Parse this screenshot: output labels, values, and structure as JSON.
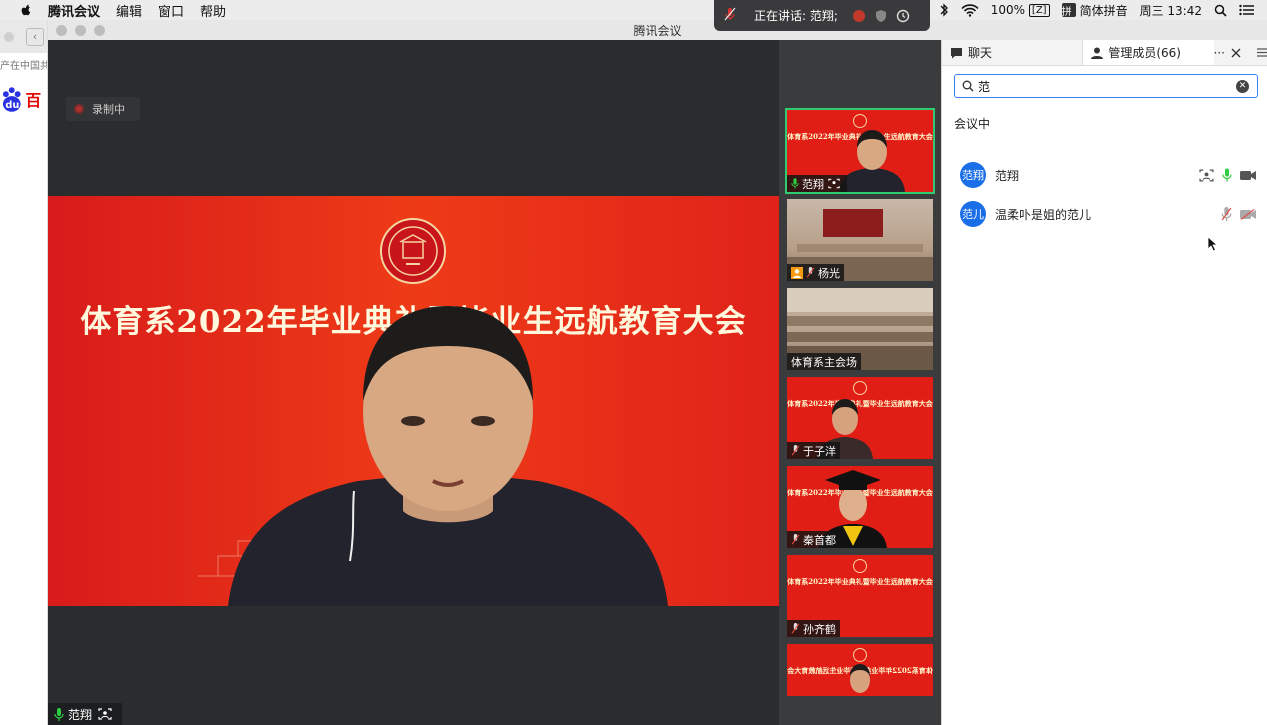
{
  "menubar": {
    "app": "腾讯会议",
    "items": [
      "编辑",
      "窗口",
      "帮助"
    ],
    "battery": "100%",
    "battery_badge": "[Z]",
    "ime_badge": "拼",
    "ime": "简体拼音",
    "clock": "周三 13:42"
  },
  "speaking": {
    "text": "正在讲话: 范翔;"
  },
  "browser": {
    "partial_text": "产在中国共产",
    "logo": "du百"
  },
  "window": {
    "title": "腾讯会议"
  },
  "stage": {
    "recording": "录制中",
    "banner_title": "体育系2022年毕业典礼暨毕业生远航教育大会",
    "speaker_name": "范翔"
  },
  "thumbnails": [
    {
      "name": "范翔",
      "type": "banner",
      "active": true
    },
    {
      "name": "杨光",
      "type": "room",
      "active": false
    },
    {
      "name": "体育系主会场",
      "type": "room",
      "active": false
    },
    {
      "name": "于子洋",
      "type": "banner",
      "active": false
    },
    {
      "name": "秦首都",
      "type": "banner",
      "active": false
    },
    {
      "name": "孙齐鹤",
      "type": "banner",
      "active": false
    },
    {
      "name": "",
      "type": "banner",
      "active": false
    }
  ],
  "thumb_title": "体育系2022年毕业典礼暨毕业生远航教育大会",
  "panel": {
    "tab_chat": "聊天",
    "tab_members": "管理成员(66)",
    "more": "···",
    "search_value": "范",
    "section": "会议中",
    "members": [
      {
        "avatar": "范翔",
        "name": "范翔",
        "mic": "on",
        "video": "on"
      },
      {
        "avatar": "范儿",
        "name": "温柔卟是姐的范儿",
        "mic": "off",
        "video": "off"
      }
    ]
  },
  "colors": {
    "accent": "#1a6ee8",
    "banner_red": "#e0221a",
    "active_green": "#2ecc71"
  }
}
